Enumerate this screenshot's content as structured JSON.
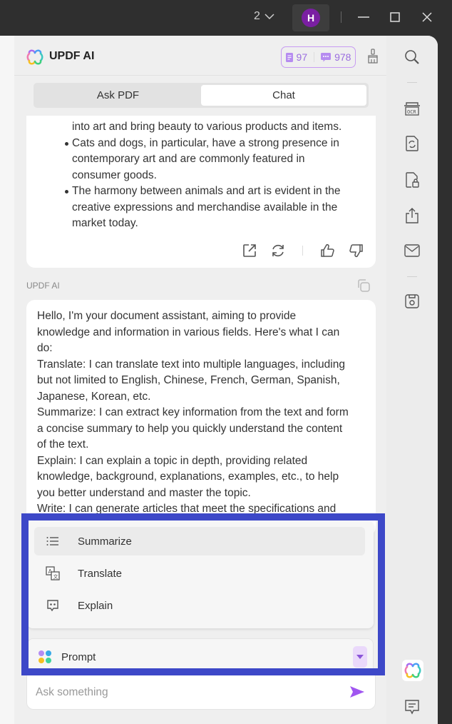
{
  "titlebar": {
    "window_count": "2",
    "avatar_initial": "H",
    "avatar_color": "#7a1fa2"
  },
  "header": {
    "brand": "UPDF AI",
    "quota": {
      "pdf_count": "97",
      "chat_count": "978"
    },
    "accent": "#9a6ddf"
  },
  "tabs": [
    {
      "label": "Ask PDF",
      "active": false
    },
    {
      "label": "Chat",
      "active": true
    }
  ],
  "prev_message": {
    "lines": [
      {
        "text": "into art and bring beauty to various products and items.",
        "bullet": false
      },
      {
        "text": "Cats and dogs, in particular, have a strong presence in",
        "bullet": true
      },
      {
        "text": "contemporary art and are commonly featured in",
        "bullet": false
      },
      {
        "text": "consumer goods.",
        "bullet": false
      },
      {
        "text": "The harmony between animals and art is evident in the",
        "bullet": true
      },
      {
        "text": "creative expressions and merchandise available in the",
        "bullet": false
      },
      {
        "text": "market today.",
        "bullet": false
      }
    ],
    "actions": [
      "export-icon",
      "regenerate-icon",
      "thumbs-up-icon",
      "thumbs-down-icon"
    ]
  },
  "ai_message": {
    "sender": "UPDF AI",
    "lines": [
      "Hello, I'm your document assistant, aiming to provide",
      "knowledge and information in various fields. Here's what I can",
      "do:",
      "Translate: I can translate text into multiple languages, including",
      "but not limited to English, Chinese, French, German, Spanish,",
      "Japanese, Korean, etc.",
      "Summarize: I can extract key information from the text and form",
      "a concise summary to help you quickly understand the content",
      "of the text.",
      "Explain: I can explain a topic in depth, providing related",
      "knowledge, background, explanations, examples, etc., to help",
      "you better understand and master the topic.",
      "Write: I can generate articles that meet the specifications and"
    ]
  },
  "prompt_menu": {
    "items": [
      {
        "label": "Summarize",
        "icon": "list-icon",
        "highlighted": true
      },
      {
        "label": "Translate",
        "icon": "translate-icon",
        "highlighted": false
      },
      {
        "label": "Explain",
        "icon": "explain-icon",
        "highlighted": false
      }
    ]
  },
  "prompt_selector": {
    "label": "Prompt"
  },
  "input": {
    "placeholder": "Ask something",
    "value": ""
  },
  "right_toolbar": [
    "search-icon",
    "ocr-icon",
    "convert-icon",
    "protect-icon",
    "share-icon",
    "email-icon",
    "save-icon",
    "updf-ai-icon",
    "comment-icon"
  ],
  "highlight_color": "#3d48c8"
}
